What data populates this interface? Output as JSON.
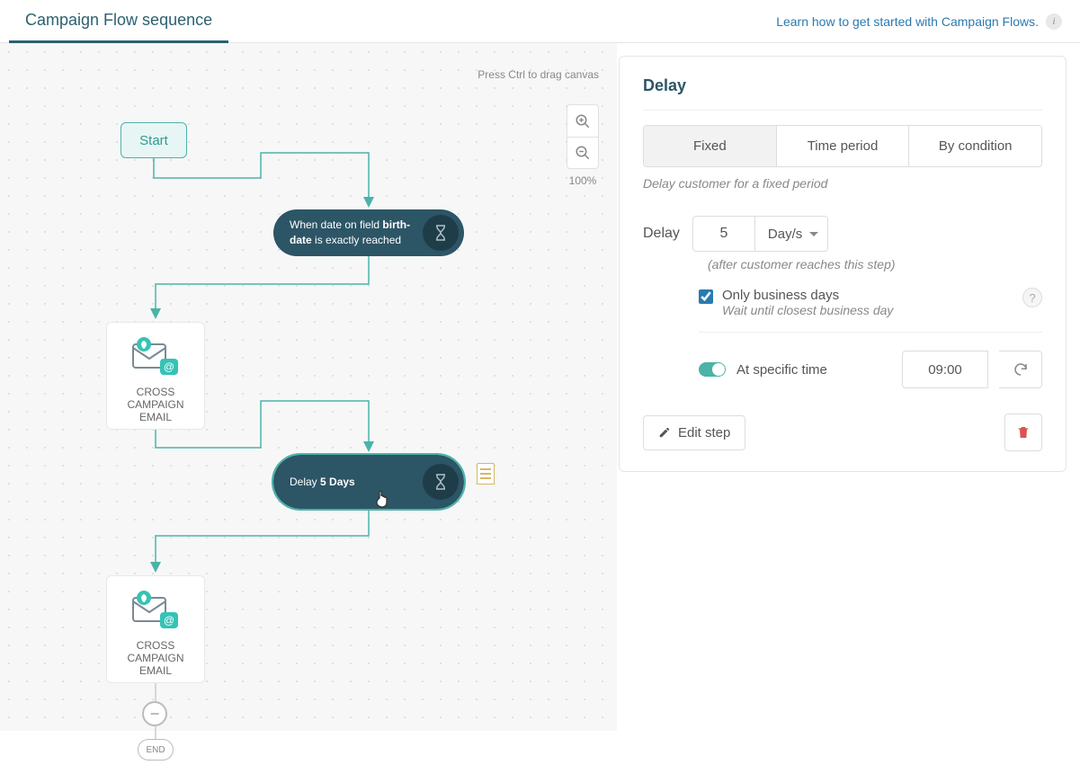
{
  "header": {
    "title": "Campaign Flow sequence",
    "help_link": "Learn how to get started with Campaign Flows."
  },
  "canvas": {
    "hint": "Press Ctrl to drag canvas",
    "zoom_level": "100%",
    "start_label": "Start",
    "condition1_prefix": "When date on field ",
    "condition1_bold": "birth-date",
    "condition1_suffix": " is exactly reached",
    "delay_prefix": "Delay ",
    "delay_bold": "5 Days",
    "email1_label": "CROSS CAMPAIGN EMAIL",
    "email2_label": "CROSS CAMPAIGN EMAIL",
    "end_label": "END"
  },
  "panel": {
    "title": "Delay",
    "tabs": {
      "fixed": "Fixed",
      "time_period": "Time period",
      "by_condition": "By condition"
    },
    "tab_desc": "Delay customer for a fixed period",
    "delay_label": "Delay",
    "delay_value": "5",
    "delay_unit": "Day/s",
    "after_note": "(after customer reaches this step)",
    "business_days_label": "Only business days",
    "business_days_sub": "Wait until closest business day",
    "specific_time_label": "At specific time",
    "time_value": "09:00",
    "edit_step": "Edit step"
  }
}
